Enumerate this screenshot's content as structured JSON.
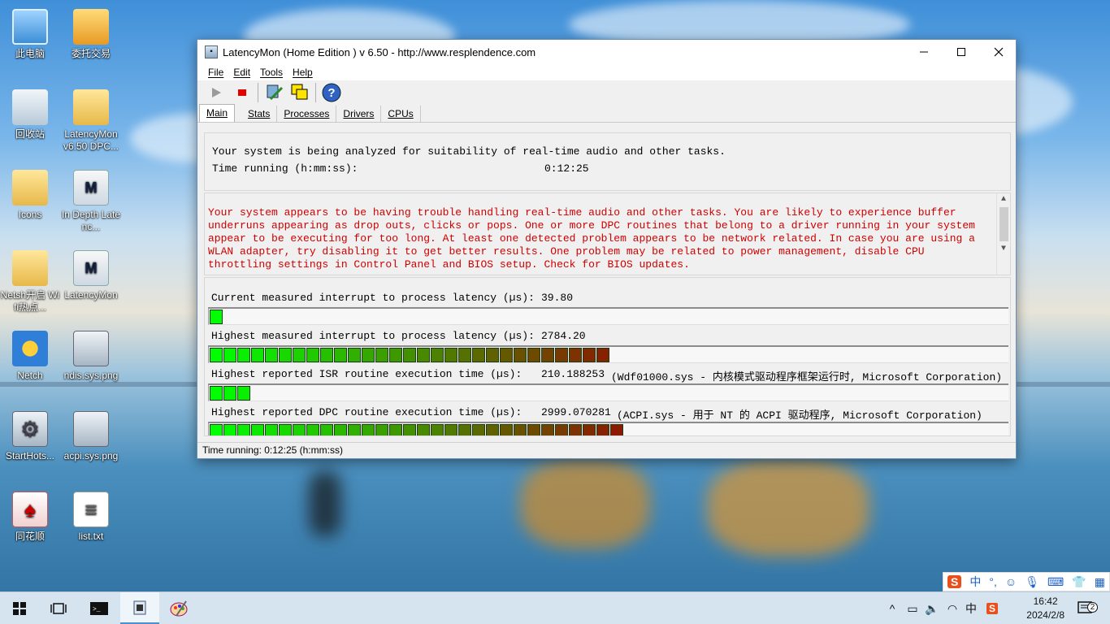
{
  "desktop": {
    "icons": [
      {
        "label": "此电脑"
      },
      {
        "label": "委托交易"
      },
      {
        "label": "回收站"
      },
      {
        "label": "LatencyMon v6.50 DPC..."
      },
      {
        "label": "Icons"
      },
      {
        "label": "In Depth Latenc..."
      },
      {
        "label": "Netsh开启 Wifi热点..."
      },
      {
        "label": "LatencyMon"
      },
      {
        "label": "Netch"
      },
      {
        "label": "ndis.sys.png"
      },
      {
        "label": "StartHots..."
      },
      {
        "label": "acpi.sys.png"
      },
      {
        "label": "同花顺"
      },
      {
        "label": "list.txt"
      }
    ]
  },
  "window": {
    "title": "LatencyMon  (Home Edition )  v 6.50 - http://www.resplendence.com",
    "menu": [
      "File",
      "Edit",
      "Tools",
      "Help"
    ],
    "tabs": [
      "Main",
      "Stats",
      "Processes",
      "Drivers",
      "CPUs"
    ],
    "active_tab": "Main",
    "info": {
      "line1": "Your system is being analyzed for suitability of real-time audio and other tasks.",
      "time_label": "Time running (h:mm:ss):",
      "time_value": "0:12:25"
    },
    "warning": [
      "Your system appears to be having trouble handling real-time audio and other tasks. You are likely to experience buffer",
      "underruns appearing as drop outs, clicks or pops. One or more DPC routines that belong to a driver running in your system",
      "appear to be executing for too long. At least one detected problem appears to be network related. In case you are using a",
      "WLAN adapter, try disabling it to get better results. One problem may be related to power management, disable CPU",
      "throttling settings in Control Panel and BIOS setup. Check for BIOS updates."
    ],
    "metrics": [
      {
        "label": "Current measured interrupt to process latency (µs):",
        "value": "39.80",
        "detail": "",
        "segments": 1
      },
      {
        "label": "Highest measured interrupt to process latency (µs):",
        "value": "2784.20",
        "detail": "",
        "segments": 29
      },
      {
        "label": "Highest reported ISR routine execution time (µs):",
        "value": "210.188253",
        "detail": "(Wdf01000.sys - 内核模式驱动程序框架运行时, Microsoft Corporation)",
        "segments": 3
      },
      {
        "label": "Highest reported DPC routine execution time (µs):",
        "value": "2999.070281",
        "detail": "(ACPI.sys - 用于 NT 的 ACPI 驱动程序, Microsoft Corporation)",
        "segments": 30
      }
    ],
    "status": "Time running: 0:12:25  (h:mm:ss)"
  },
  "taskbar": {
    "time": "16:42",
    "date": "2024/2/8",
    "notification_count": "2",
    "ime_label": "中"
  },
  "colors": {
    "bar_start": "#00ff00",
    "bar_end": "#8b1a00",
    "warning_text": "#d00000"
  }
}
